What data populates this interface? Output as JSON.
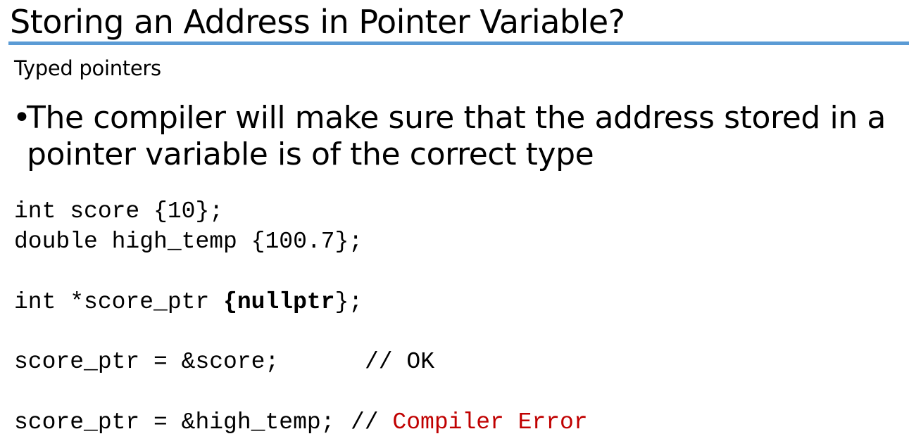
{
  "slide": {
    "title": "Storing an Address in Pointer Variable?",
    "subtitle": "Typed pointers",
    "bullet": {
      "marker": "•",
      "text": "The compiler will make sure that the address stored in a pointer variable is of the correct type"
    },
    "code": {
      "line1": "int score {10};",
      "line2": "double high_temp {100.7};",
      "line3_prefix": "int *score_ptr ",
      "line3_bold": "{nullptr",
      "line3_suffix": "};",
      "line4": "score_ptr = &score;",
      "line4_comment": "// OK",
      "line5": "score_ptr = &high_temp;",
      "line5_comment_prefix": "// ",
      "line5_comment_error": "Compiler Error"
    },
    "colors": {
      "title_rule": "#5b9bd5",
      "error_text": "#c00000"
    }
  }
}
